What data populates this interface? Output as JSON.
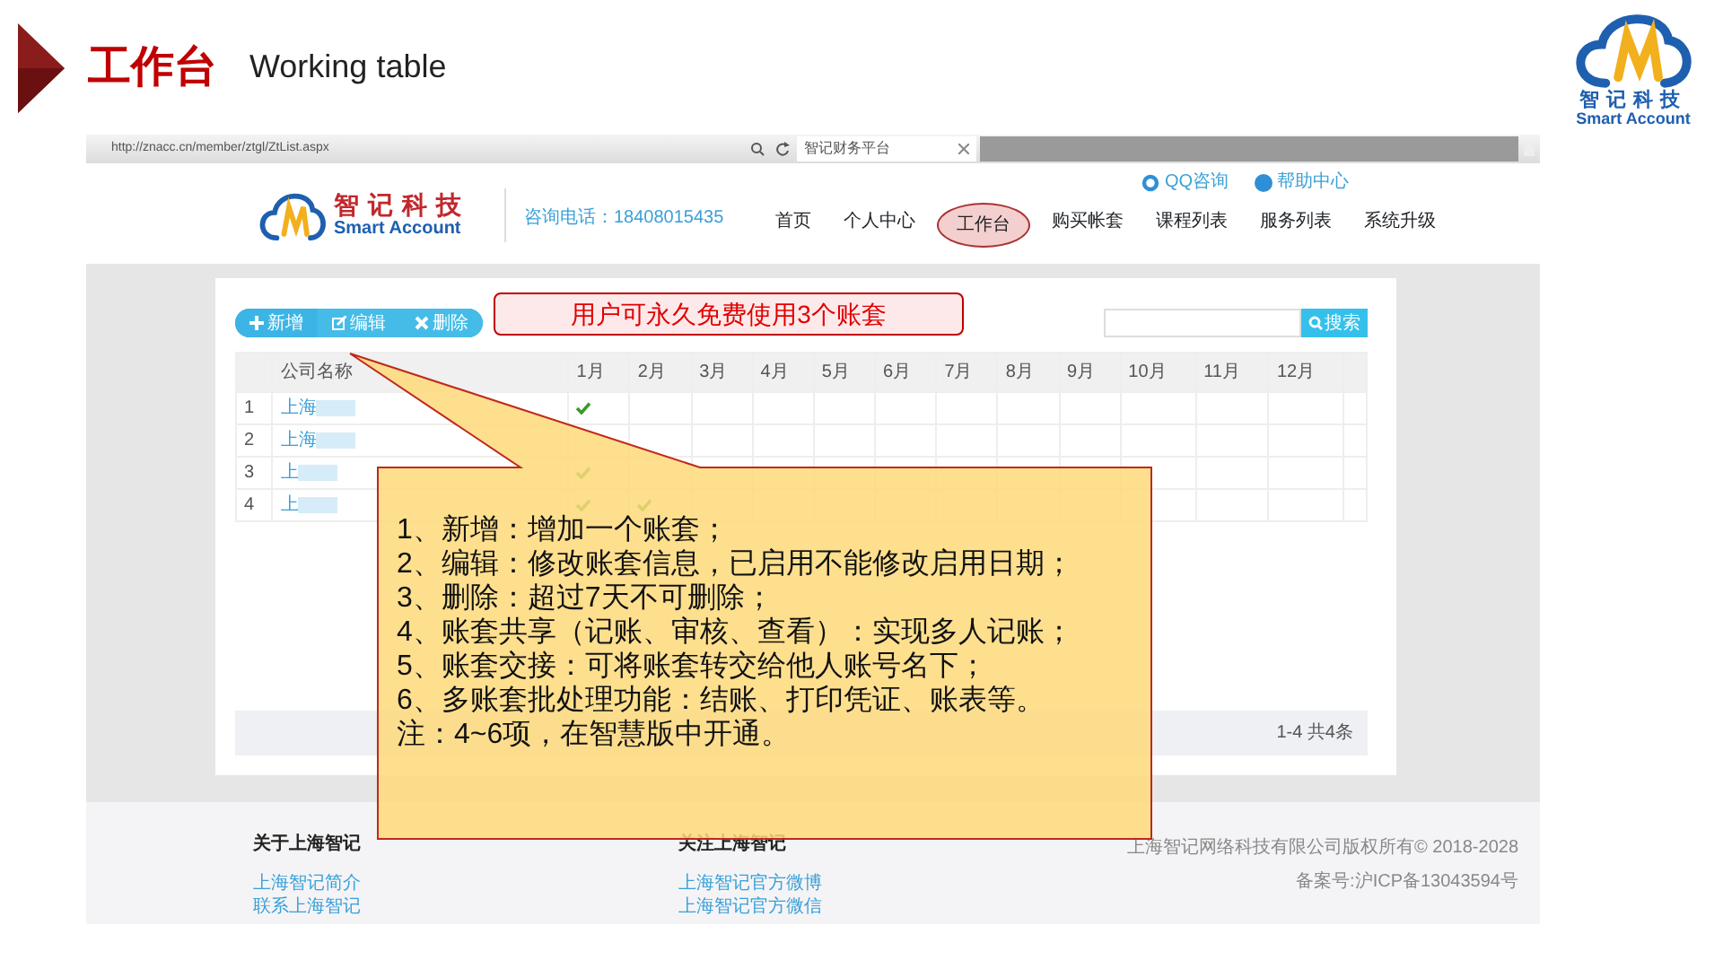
{
  "slide": {
    "title": "工作台",
    "subtitle": "Working table",
    "logo": {
      "name": "智记科技",
      "tagline": "Smart Account"
    }
  },
  "browser": {
    "url": "http://znacc.cn/member/ztgl/ZtList.aspx",
    "tab_title": "智记财务平台"
  },
  "site_header": {
    "logo": {
      "name": "智记科技",
      "tagline": "Smart Account"
    },
    "phone": "咨询电话：18408015435",
    "top_links": [
      "QQ咨询",
      "帮助中心"
    ],
    "nav": [
      {
        "label": "首页",
        "selected": false
      },
      {
        "label": "个人中心",
        "selected": false
      },
      {
        "label": "工作台",
        "selected": true
      },
      {
        "label": "购买帐套",
        "selected": false
      },
      {
        "label": "课程列表",
        "selected": false
      },
      {
        "label": "服务列表",
        "selected": false
      },
      {
        "label": "系统升级",
        "selected": false
      }
    ]
  },
  "toolbar": {
    "buttons": [
      "新增",
      "编辑",
      "删除"
    ],
    "search_button": "搜索"
  },
  "notice": "用户可永久免费使用3个账套",
  "table": {
    "columns": [
      "公司名称",
      "1月",
      "2月",
      "3月",
      "4月",
      "5月",
      "6月",
      "7月",
      "8月",
      "9月",
      "10月",
      "11月",
      "12月"
    ],
    "rows": [
      {
        "index": "1",
        "company": "上海",
        "months": [
          true,
          false,
          false,
          false,
          false,
          false,
          false,
          false,
          false,
          false,
          false,
          false
        ]
      },
      {
        "index": "2",
        "company": "上海",
        "months": [
          false,
          false,
          false,
          false,
          false,
          false,
          false,
          false,
          false,
          false,
          false,
          false
        ]
      },
      {
        "index": "3",
        "company": "上",
        "months": [
          true,
          false,
          false,
          false,
          false,
          false,
          false,
          false,
          false,
          false,
          false,
          false
        ]
      },
      {
        "index": "4",
        "company": "上",
        "months": [
          true,
          true,
          false,
          false,
          false,
          false,
          false,
          false,
          false,
          false,
          false,
          false
        ]
      }
    ]
  },
  "pagination": {
    "summary": "1-4 共4条"
  },
  "callout": {
    "lines": [
      "1、新增：增加一个账套；",
      "2、编辑：修改账套信息，已启用不能修改启用日期；",
      "3、删除：超过7天不可删除；",
      "4、账套共享（记账、审核、查看）：实现多人记账；",
      "5、账套交接：可将账套转交给他人账号名下；",
      "6、多账套批处理功能：结账、打印凭证、账表等。",
      "注：4~6项，在智慧版中开通。"
    ]
  },
  "footer": {
    "columns": [
      {
        "heading": "关于上海智记",
        "links": [
          "上海智记简介",
          "联系上海智记"
        ]
      },
      {
        "heading": "关注上海智记",
        "links": [
          "上海智记官方微博",
          "上海智记官方微信"
        ]
      }
    ],
    "copyright": "上海智记网络科技有限公司版权所有© 2018-2028",
    "icp": "备案号:沪ICP备13043594号"
  }
}
